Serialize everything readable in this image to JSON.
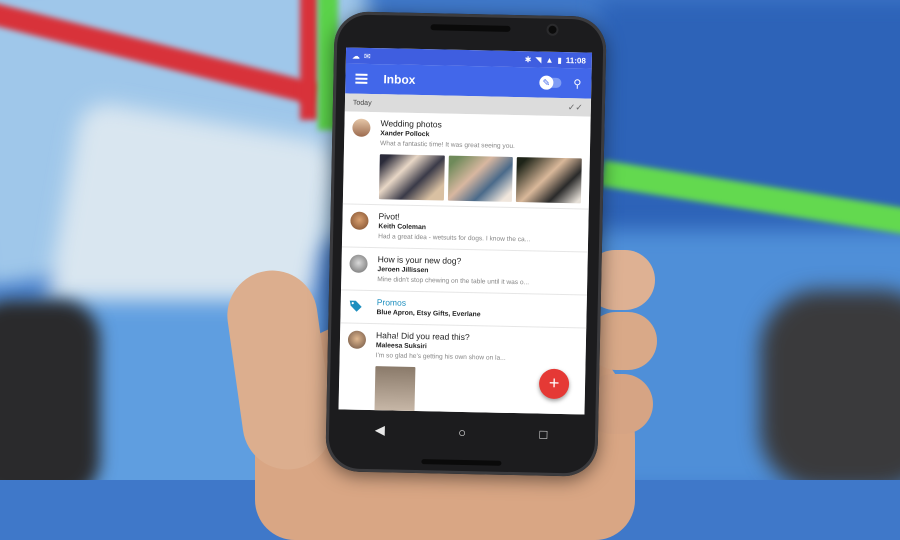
{
  "statusbar": {
    "time": "11:08"
  },
  "appbar": {
    "title": "Inbox"
  },
  "section": {
    "label": "Today"
  },
  "emails": [
    {
      "subject": "Wedding photos",
      "sender": "Xander Pollock",
      "snippet": "What a fantastic time! It was great seeing you."
    },
    {
      "subject": "Pivot!",
      "sender": "Keith Coleman",
      "snippet": "Had a great idea - wetsuits for dogs. I know the ca..."
    },
    {
      "subject": "How is your new dog?",
      "sender": "Jeroen Jillissen",
      "snippet": "Mine didn't stop chewing on the table until it was o..."
    },
    {
      "subject": "Promos",
      "sender": "Blue Apron, Etsy Gifts, Everlane",
      "snippet": ""
    },
    {
      "subject": "Haha! Did you read this?",
      "sender": "Maleesa Suksiri",
      "snippet": "I'm so glad he's getting his own show on la..."
    }
  ],
  "fab": {
    "label": "+"
  },
  "nav": {
    "back": "◀",
    "home": "○",
    "recents": "□"
  },
  "colors": {
    "appbar": "#4267ea",
    "statusbar": "#3f5ee0",
    "fab": "#e53935",
    "promo": "#1e8fbf"
  }
}
